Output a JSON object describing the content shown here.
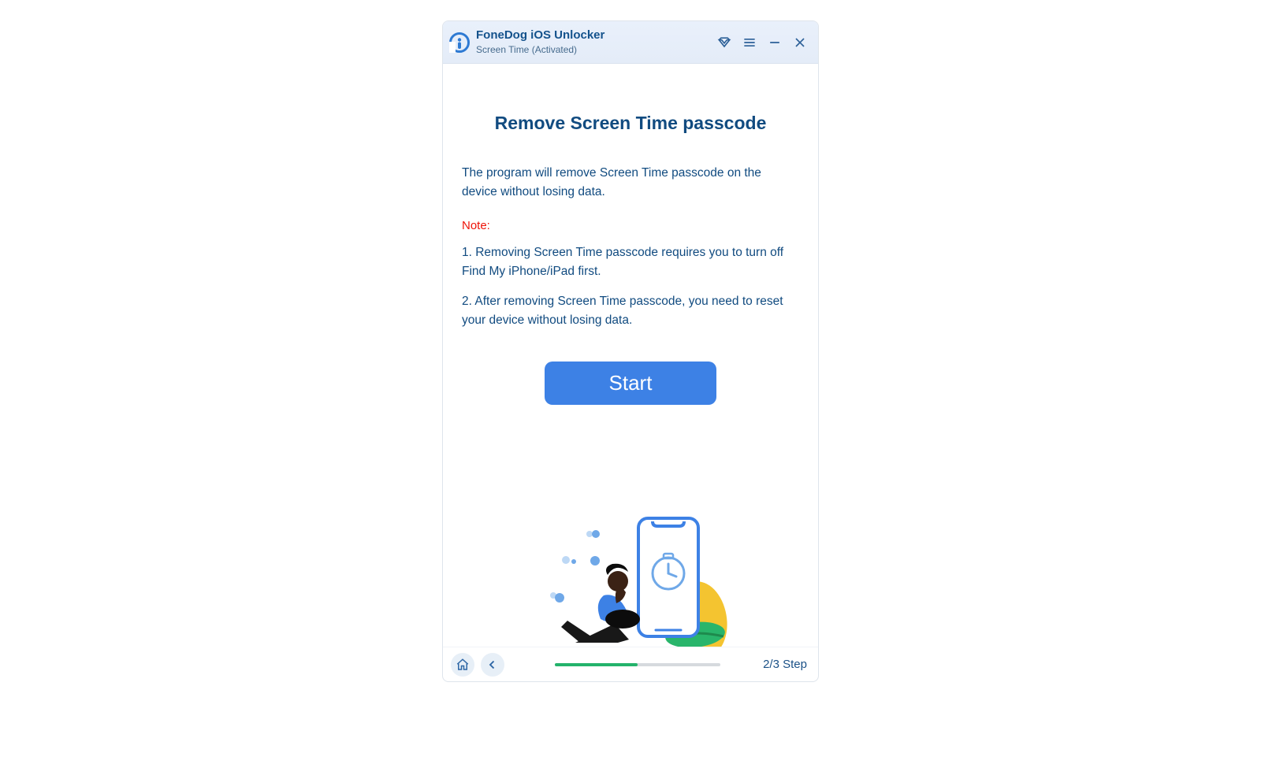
{
  "title": {
    "appName": "FoneDog iOS Unlocker",
    "subtitle": "Screen Time  (Activated)"
  },
  "main": {
    "heading": "Remove Screen Time passcode",
    "description": "The program will remove Screen Time passcode on the device without losing data.",
    "noteLabel": "Note:",
    "note1": "1. Removing Screen Time passcode requires you to turn off Find My iPhone/iPad first.",
    "note2": "2. After removing Screen Time passcode, you need to reset your device without losing data.",
    "startButton": "Start"
  },
  "footer": {
    "stepLabel": "2/3 Step",
    "progressPercent": 50
  }
}
